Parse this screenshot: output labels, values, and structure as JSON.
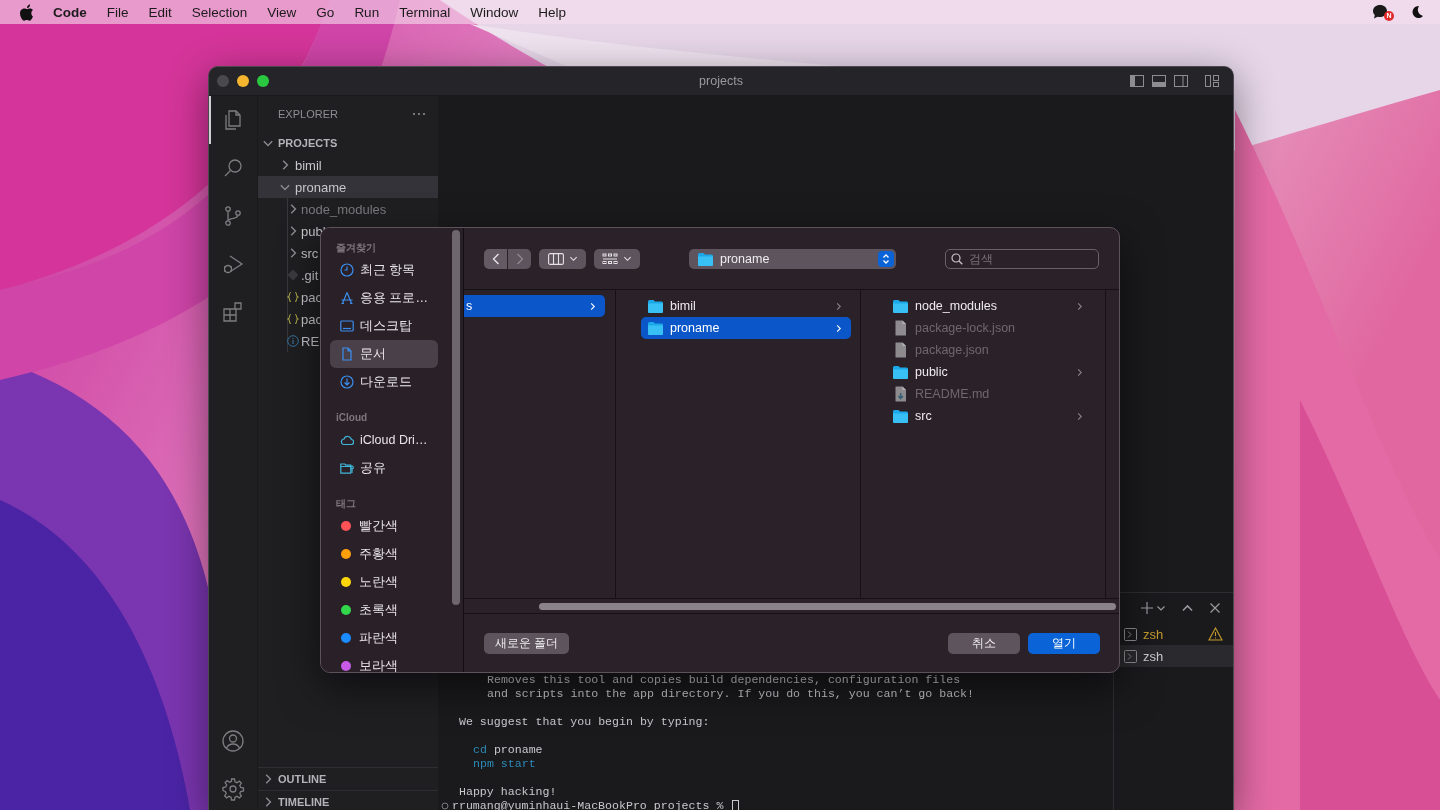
{
  "menu_bar": {
    "app": "Code",
    "items": [
      "File",
      "Edit",
      "Selection",
      "View",
      "Go",
      "Run",
      "Terminal",
      "Window",
      "Help"
    ],
    "badge": "N"
  },
  "window": {
    "title": "projects"
  },
  "explorer": {
    "title": "EXPLORER",
    "root": {
      "label": "PROJECTS",
      "expanded": true
    },
    "tree": [
      {
        "label": "bimil",
        "kind": "folder",
        "expanded": false,
        "selected": false,
        "ignored": false
      },
      {
        "label": "proname",
        "kind": "folder",
        "expanded": true,
        "selected": true,
        "ignored": false,
        "children": [
          {
            "label": "node_modules",
            "kind": "folder",
            "expanded": false,
            "selected": false,
            "ignored": true
          },
          {
            "label": "publ",
            "kind": "folder",
            "expanded": false,
            "selected": false,
            "ignored": false
          },
          {
            "label": "src",
            "kind": "folder",
            "expanded": false,
            "selected": false,
            "ignored": false
          },
          {
            "label": ".git",
            "kind": "git",
            "selected": false,
            "ignored": false
          },
          {
            "label": "pac",
            "kind": "json",
            "selected": false,
            "ignored": false
          },
          {
            "label": "pac",
            "kind": "json",
            "selected": false,
            "ignored": false
          },
          {
            "label": "RE",
            "kind": "info",
            "selected": false,
            "ignored": false
          }
        ]
      }
    ],
    "panels": [
      {
        "label": "OUTLINE",
        "expanded": false
      },
      {
        "label": "TIMELINE",
        "expanded": false
      }
    ]
  },
  "terminal": {
    "lines": [
      {
        "kind": "note",
        "text": "Removes this tool and copies build dependencies, configuration files"
      },
      {
        "kind": "note",
        "text": "and scripts into the app directory. If you do this, you can’t go back!"
      },
      {
        "kind": "blank"
      },
      {
        "kind": "text",
        "text": "We suggest that you begin by typing:"
      },
      {
        "kind": "blank"
      },
      {
        "kind": "command",
        "command": "cd",
        "arg": "proname"
      },
      {
        "kind": "command",
        "command": "npm start"
      },
      {
        "kind": "blank"
      },
      {
        "kind": "text",
        "text": "Happy hacking!"
      }
    ],
    "prompt": "rrumang@yuminhaui-MacBookPro projects %",
    "tabs": [
      {
        "label": "zsh",
        "warning": true,
        "selected": false
      },
      {
        "label": "zsh",
        "warning": false,
        "selected": true
      }
    ]
  },
  "dialog": {
    "sidebar": [
      {
        "heading": "즐겨찾기",
        "items": [
          {
            "label": "최근 항목",
            "kind": "recents",
            "selected": false
          },
          {
            "label": "응용 프로…",
            "kind": "applications",
            "selected": false
          },
          {
            "label": "데스크탑",
            "kind": "desktop",
            "selected": false
          },
          {
            "label": "문서",
            "kind": "documents",
            "selected": true
          },
          {
            "label": "다운로드",
            "kind": "downloads",
            "selected": false
          }
        ]
      },
      {
        "heading": "iCloud",
        "items": [
          {
            "label": "iCloud Dri…",
            "kind": "cloud",
            "selected": false
          },
          {
            "label": "공유",
            "kind": "shared",
            "selected": false
          }
        ]
      },
      {
        "heading": "태그",
        "items": [
          {
            "label": "빨간색",
            "kind": "tag",
            "color": "#ff5257",
            "selected": false
          },
          {
            "label": "주황색",
            "kind": "tag",
            "color": "#ff9f0a",
            "selected": false
          },
          {
            "label": "노란색",
            "kind": "tag",
            "color": "#ffd60a",
            "selected": false
          },
          {
            "label": "초록색",
            "kind": "tag",
            "color": "#32d74b",
            "selected": false
          },
          {
            "label": "파란색",
            "kind": "tag",
            "color": "#1a8cff",
            "selected": false
          },
          {
            "label": "보라색",
            "kind": "tag",
            "color": "#c95ae8",
            "selected": false
          }
        ]
      }
    ],
    "path": "proname",
    "search": {
      "placeholder": "검색"
    },
    "columns": [
      [
        {
          "label": "s",
          "kind": "folder",
          "selected": true,
          "disabled": false
        }
      ],
      [
        {
          "label": "bimil",
          "kind": "folder",
          "selected": false,
          "disabled": false
        },
        {
          "label": "proname",
          "kind": "folder",
          "selected": true,
          "disabled": false
        }
      ],
      [
        {
          "label": "node_modules",
          "kind": "folder",
          "selected": false,
          "disabled": false
        },
        {
          "label": "package-lock.json",
          "kind": "file",
          "selected": false,
          "disabled": true
        },
        {
          "label": "package.json",
          "kind": "file",
          "selected": false,
          "disabled": true
        },
        {
          "label": "public",
          "kind": "folder",
          "selected": false,
          "disabled": false
        },
        {
          "label": "README.md",
          "kind": "document",
          "selected": false,
          "disabled": true
        },
        {
          "label": "src",
          "kind": "folder",
          "selected": false,
          "disabled": false
        }
      ]
    ],
    "buttons": [
      {
        "label": "새로운 폴더",
        "kind": "secondary"
      },
      {
        "label": "취소",
        "kind": "secondary"
      },
      {
        "label": "열기",
        "kind": "primary"
      }
    ]
  }
}
